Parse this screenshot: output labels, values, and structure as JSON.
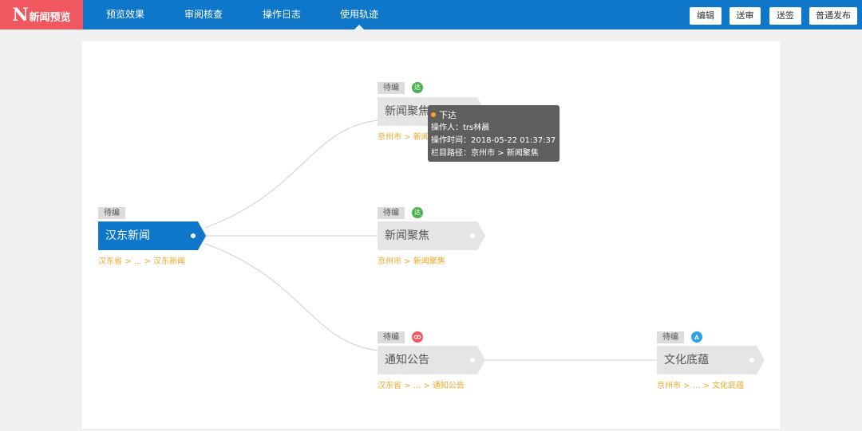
{
  "app": {
    "logo_letter": "N",
    "logo_text": "新闻预览"
  },
  "nav": {
    "preview": "预览效果",
    "review": "审阅核查",
    "log": "操作日志",
    "trace": "使用轨迹"
  },
  "toolbar": {
    "edit": "编辑",
    "submit_review": "送审",
    "submit_sign": "送签",
    "publish": "普通发布"
  },
  "colors": {
    "header": "#0e77c9",
    "logo_bg": "#f0575e",
    "root_node": "#0e77c9",
    "child_node": "#e5e5e5",
    "path_text": "#f5a623",
    "status_issue": "#4caf50",
    "status_link": "#f0575e",
    "status_push": "#29a3e8"
  },
  "nodes": {
    "root": {
      "tag": "待编",
      "label": "汉东新闻",
      "path": "汉东省 > ... > 汉东新闻"
    },
    "n1": {
      "tag": "待编",
      "status_icon": "check-issue-icon",
      "status_text": "达",
      "label": "新闻聚焦",
      "path": "京州市 > 新闻聚焦"
    },
    "n2": {
      "tag": "待编",
      "status_icon": "check-issue-icon",
      "status_text": "达",
      "label": "新闻聚焦",
      "path": "京州市 > 新闻聚焦"
    },
    "n3": {
      "tag": "待编",
      "status_icon": "link-icon",
      "status_text": "",
      "label": "通知公告",
      "path": "汉东省 > ... > 通知公告"
    },
    "n4": {
      "tag": "待编",
      "status_icon": "push-icon",
      "status_text": "",
      "label": "文化底蕴",
      "path": "京州市 > ... > 文化底蕴"
    }
  },
  "tooltip": {
    "title": "下达",
    "operator": "操作人：trs林晨",
    "time": "操作时间：2018-05-22 01:37:37",
    "column_path": "栏目路径：京州市 > 新闻聚焦"
  }
}
